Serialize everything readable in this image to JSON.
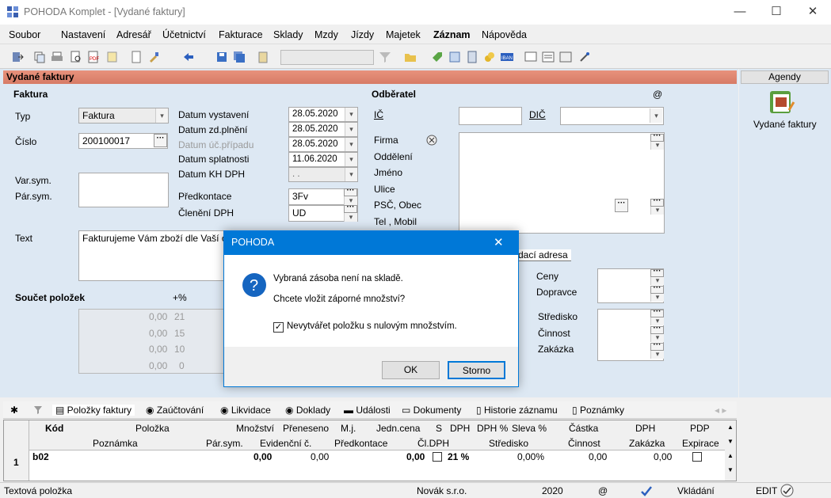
{
  "window": {
    "title": "POHODA Komplet - [Vydané faktury]",
    "minimize": "—",
    "maximize": "☐",
    "close": "✕"
  },
  "menu": [
    "Soubor",
    "Nastavení",
    "Adresář",
    "Účetnictví",
    "Fakturace",
    "Sklady",
    "Mzdy",
    "Jízdy",
    "Majetek",
    "Záznam",
    "Nápověda"
  ],
  "panel": {
    "title": "Vydané faktury"
  },
  "faktura": {
    "section": "Faktura",
    "typ_label": "Typ",
    "typ_value": "Faktura",
    "cislo_label": "Číslo",
    "cislo_value": "200100017",
    "varsym_label": "Var.sym.",
    "parsym_label": "Pár.sym.",
    "text_label": "Text",
    "text_value": "Fakturujeme Vám zboží dle Vaší ob"
  },
  "dates": {
    "vystaveni_label": "Datum vystavení",
    "vystaveni": "28.05.2020",
    "zdplneni_label": "Datum zd.plnění",
    "zdplneni": "28.05.2020",
    "ucpripadu_label": "Datum úč.případu",
    "ucpripadu": "28.05.2020",
    "splatnosti_label": "Datum splatnosti",
    "splatnosti": "11.06.2020",
    "khdph_label": "Datum KH DPH",
    "khdph": ". ."
  },
  "predkontace": {
    "label": "Předkontace",
    "value": "3Fv"
  },
  "cleneni": {
    "label": "Členění DPH",
    "value": "UD"
  },
  "soucet": {
    "label": "Součet položek",
    "percent": "+%",
    "rows": [
      {
        "v": "0,00",
        "p": "21"
      },
      {
        "v": "0,00",
        "p": "15"
      },
      {
        "v": "0,00",
        "p": "10"
      },
      {
        "v": "0,00",
        "p": "0"
      }
    ]
  },
  "odberatel": {
    "section": "Odběratel",
    "at": "@",
    "ic": "IČ",
    "dic": "DIČ",
    "firma": "Firma",
    "oddeleni": "Oddělení",
    "jmeno": "Jméno",
    "ulice": "Ulice",
    "psc": "PSČ, Obec",
    "tel": "Tel , Mobil",
    "dodaci_tab": "dací adresa"
  },
  "right_fields": {
    "ceny": "Ceny",
    "dopravce": "Dopravce",
    "stredisko": "Středisko",
    "cinnost": "Činnost",
    "zakazka": "Zakázka"
  },
  "agendy": {
    "header": "Agendy",
    "item": "Vydané faktury"
  },
  "tabs": [
    "Položky faktury",
    "Zaúčtování",
    "Likvidace",
    "Doklady",
    "Události",
    "Dokumenty",
    "Historie záznamu",
    "Poznámky"
  ],
  "grid": {
    "header1": [
      "Kód",
      "Položka",
      "Množství",
      "Přeneseno",
      "M.j.",
      "Jedn.cena",
      "S",
      "DPH",
      "DPH %",
      "Sleva %",
      "Částka",
      "DPH",
      "PDP"
    ],
    "header2": [
      "Poznámka",
      "Pár.sym.",
      "Evidenční č.",
      "Předkontace",
      "Čl.DPH",
      "Středisko",
      "Činnost",
      "Zakázka",
      "Expirace"
    ],
    "row": {
      "num": "1",
      "kod": "b02",
      "mnozstvi": "0,00",
      "preneseno": "0,00",
      "jcena": "0,00",
      "dphp": "21 %",
      "sleva": "0,00%",
      "castka": "0,00",
      "dph": "0,00"
    }
  },
  "status": {
    "left": "Textová položka",
    "firm": "Novák s.r.o.",
    "year": "2020",
    "at": "@",
    "mode": "Vkládání",
    "edit": "EDIT"
  },
  "dialog": {
    "title": "POHODA",
    "line1": "Vybraná zásoba není na skladě.",
    "line2": "Chcete vložit záporné množství?",
    "checkbox": "Nevytvářet položku s nulovým množstvím.",
    "ok": "OK",
    "cancel": "Storno",
    "close": "✕"
  }
}
